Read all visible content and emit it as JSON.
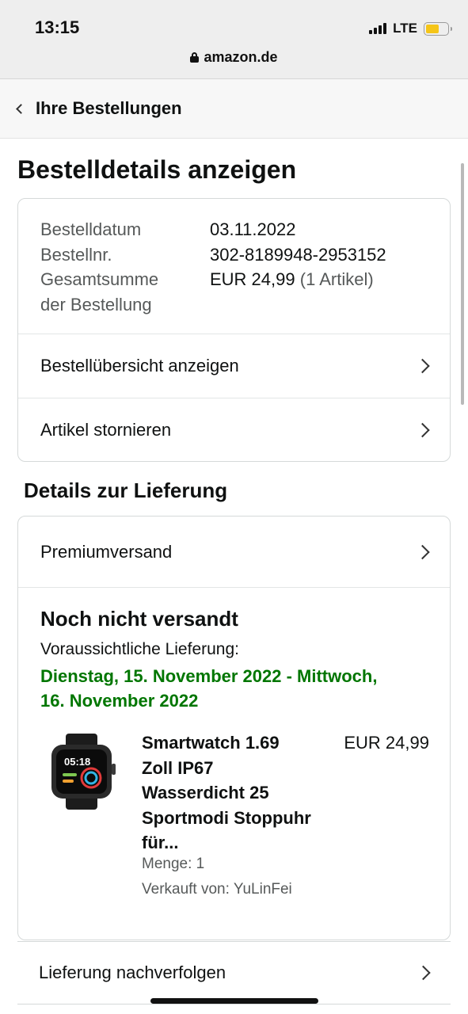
{
  "status_bar": {
    "time": "13:15",
    "network": "LTE",
    "battery_color": "#f5c518"
  },
  "browser": {
    "url": "amazon.de"
  },
  "nav": {
    "back_label": "Ihre Bestellungen"
  },
  "page": {
    "title": "Bestelldetails anzeigen"
  },
  "order": {
    "date_label": "Bestelldatum",
    "date_value": "03.11.2022",
    "number_label": "Bestellnr.",
    "number_value": "302-8189948-2953152",
    "total_label_1": "Gesamtsumme",
    "total_label_2": "der Bestellung",
    "total_value": "EUR 24,99",
    "total_count": "(1 Artikel)",
    "view_summary_label": "Bestellübersicht anzeigen",
    "cancel_label": "Artikel stornieren"
  },
  "delivery": {
    "section_title": "Details zur Lieferung",
    "shipping_method": "Premiumversand",
    "status": "Noch nicht versandt",
    "estimate_label": "Voraussichtliche Lieferung:",
    "estimate_line1": "Dienstag, 15. November 2022 - Mittwoch,",
    "estimate_line2": "16. November 2022",
    "estimate_color": "#007600",
    "item": {
      "title_lines": [
        "Smartwatch 1.69",
        "Zoll IP67",
        "Wasserdicht 25",
        "Sportmodi Stoppuhr",
        "für..."
      ],
      "price": "EUR 24,99",
      "quantity": "Menge: 1",
      "seller": "Verkauft von: YuLinFei",
      "watch_time": "05:18"
    },
    "track_label": "Lieferung nachverfolgen"
  }
}
